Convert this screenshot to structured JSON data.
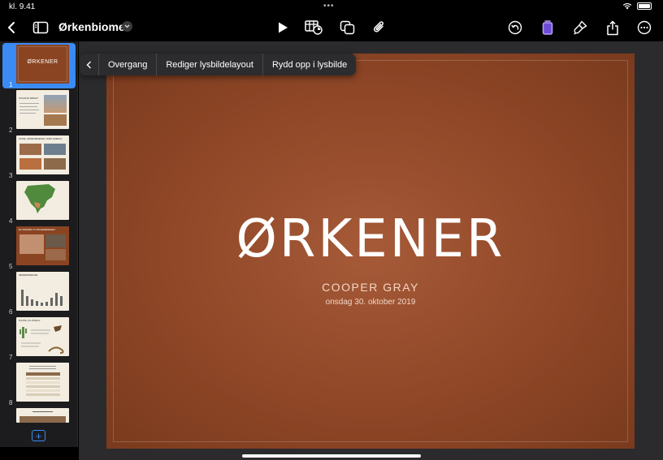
{
  "status": {
    "time": "kl. 9.41"
  },
  "toolbar": {
    "document_title": "Ørkenbiomet",
    "icons": [
      "back-icon",
      "sidebar-icon",
      "chevron-down-icon",
      "play-icon",
      "table-chart-icon",
      "shapes-icon",
      "paperclip-icon",
      "undo-icon",
      "slide-color-icon",
      "paintbrush-icon",
      "share-icon",
      "more-icon"
    ]
  },
  "navigator": {
    "selected": 1,
    "slides": [
      {
        "number": "1",
        "thumb_title": "ØRKENER"
      },
      {
        "number": "2",
        "thumb_title": "HVA ER EN ØRKEN?"
      },
      {
        "number": "3",
        "thumb_title": "STORE, VARME ØRKENER I NORD-AMERIKA"
      },
      {
        "number": "4",
        "thumb_title": ""
      },
      {
        "number": "5",
        "thumb_title": "EN VANDRING TIL MOJAVEØRKENEN"
      },
      {
        "number": "6",
        "thumb_title": "NEDBØRSMENGDE"
      },
      {
        "number": "7",
        "thumb_title": "PLANTE- OG DYRELIV"
      },
      {
        "number": "8",
        "thumb_title": ""
      },
      {
        "number": "",
        "thumb_title": ""
      }
    ],
    "add_slide_label": "+"
  },
  "context_menu": {
    "items": [
      "Overgang",
      "Rediger lysbildelayout",
      "Rydd opp i lysbilde"
    ]
  },
  "slide": {
    "title": "ØRKENER",
    "author": "COOPER GRAY",
    "date": "onsdag 30. oktober 2019"
  },
  "colors": {
    "accent": "#3a8bf4",
    "slide_brown": "#8f4727",
    "background": "#000000"
  }
}
